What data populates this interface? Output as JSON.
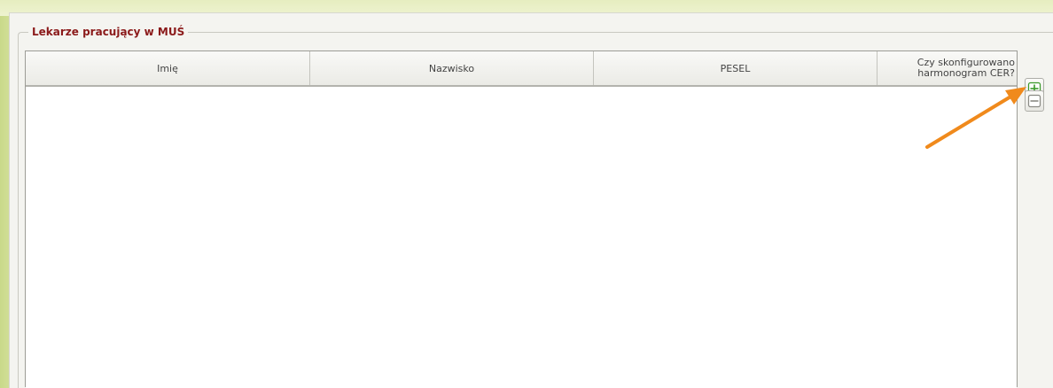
{
  "window": {
    "fieldset_legend": "Lekarze pracujący w MUŚ"
  },
  "table": {
    "columns": [
      {
        "label": "Imię"
      },
      {
        "label": "Nazwisko"
      },
      {
        "label": "PESEL"
      },
      {
        "label_line1": "Czy skonfigurowano",
        "label_line2": "harmonogram CER?"
      }
    ],
    "rows": []
  },
  "actions": {
    "add_icon": "plus-icon",
    "remove_icon": "minus-icon"
  },
  "colors": {
    "legend": "#8b1a1a",
    "add_icon": "#3a9a2a",
    "remove_icon": "#8a8a84",
    "annotation_arrow": "#f08a1c"
  }
}
